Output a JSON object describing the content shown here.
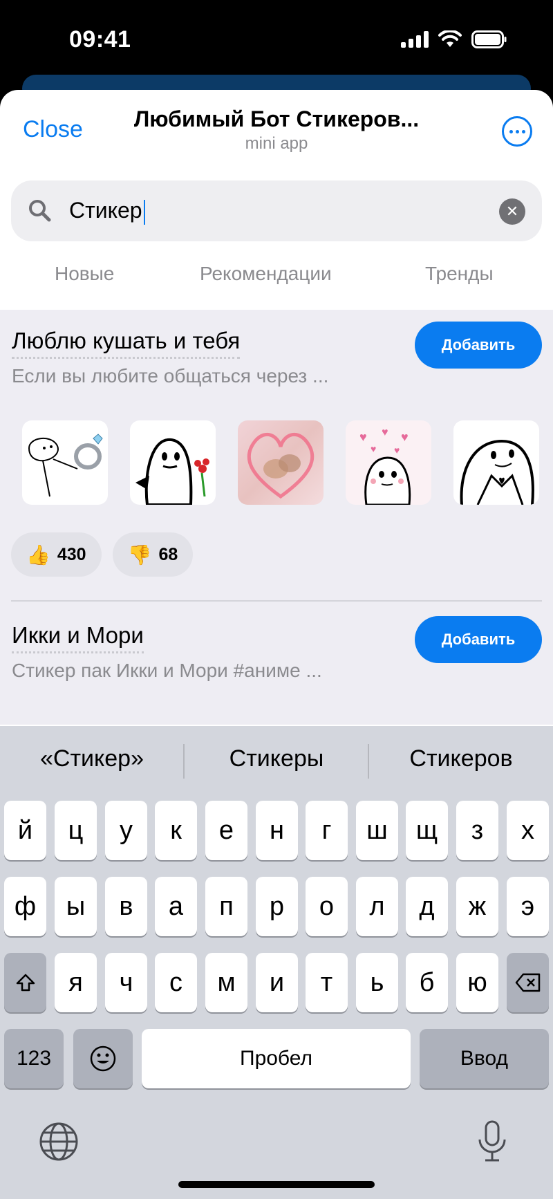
{
  "status_bar": {
    "time": "09:41"
  },
  "header": {
    "close_label": "Close",
    "title": "Любимый Бот Стикеров...",
    "subtitle": "mini app"
  },
  "search": {
    "value": "Стикер"
  },
  "tabs": [
    "Новые",
    "Рекомендации",
    "Тренды"
  ],
  "packs": [
    {
      "title": "Люблю кушать и тебя",
      "description": "Если вы любите общаться через ...",
      "add_label": "Добавить",
      "likes": "430",
      "dislikes": "68",
      "like_emoji": "👍",
      "dislike_emoji": "👎"
    },
    {
      "title": "Икки и Мори",
      "description": "Стикер пак Икки и Мори #аниме ...",
      "add_label": "Добавить"
    }
  ],
  "keyboard": {
    "suggestions": [
      "«Стикер»",
      "Стикеры",
      "Стикеров"
    ],
    "row1": [
      "й",
      "ц",
      "у",
      "к",
      "е",
      "н",
      "г",
      "ш",
      "щ",
      "з",
      "х"
    ],
    "row2": [
      "ф",
      "ы",
      "в",
      "а",
      "п",
      "р",
      "о",
      "л",
      "д",
      "ж",
      "э"
    ],
    "row3": [
      "я",
      "ч",
      "с",
      "м",
      "и",
      "т",
      "ь",
      "б",
      "ю"
    ],
    "numbers_label": "123",
    "space_label": "Пробел",
    "return_label": "Ввод"
  },
  "colors": {
    "accent": "#0a7cf0",
    "keyboard_bg": "#d3d6dd",
    "list_bg": "#eeedf3"
  }
}
